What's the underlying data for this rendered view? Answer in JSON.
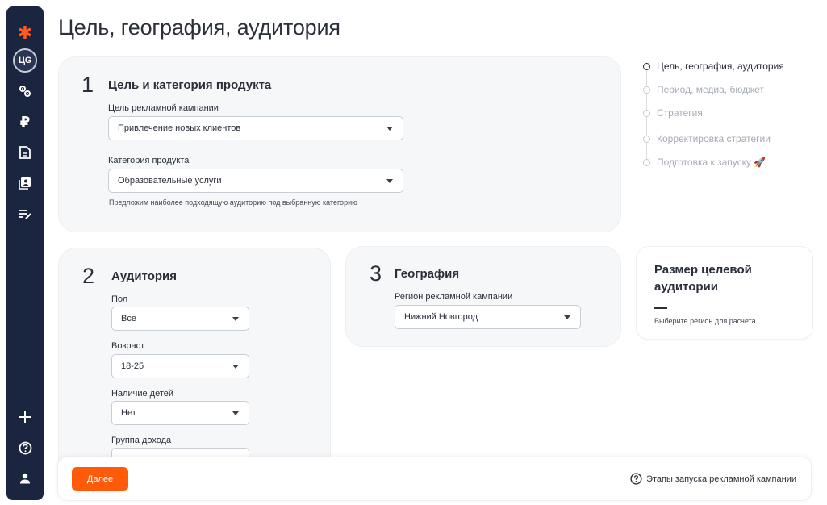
{
  "sidebar": {
    "logo_glyph": "✱",
    "avatar_initials": "ЦG",
    "ruble_glyph": "₽",
    "items": [
      {
        "icon": "gears-icon"
      },
      {
        "icon": "ruble-icon"
      },
      {
        "icon": "document-icon"
      },
      {
        "icon": "contacts-icon"
      },
      {
        "icon": "edit-list-icon"
      }
    ],
    "bottom": [
      {
        "icon": "plus-icon"
      },
      {
        "icon": "help-icon"
      },
      {
        "icon": "user-icon"
      }
    ]
  },
  "page": {
    "title": "Цель, география, аудитория"
  },
  "section_goal": {
    "number": "1",
    "title": "Цель и категория продукта",
    "goal_label": "Цель рекламной кампании",
    "goal_value": "Привлечение новых клиентов",
    "category_label": "Категория продукта",
    "category_value": "Образовательные услуги",
    "category_hint": "Предложим наиболее подходящую аудиторию под выбранную категорию"
  },
  "section_audience": {
    "number": "2",
    "title": "Аудитория",
    "gender_label": "Пол",
    "gender_value": "Все",
    "age_label": "Возраст",
    "age_value": "18-25",
    "children_label": "Наличие детей",
    "children_value": "Нет",
    "income_label": "Группа дохода"
  },
  "section_geo": {
    "number": "3",
    "title": "География",
    "region_label": "Регион рекламной кампании",
    "region_value": "Нижний Новгород"
  },
  "audience_size": {
    "title": "Размер целевой аудитории",
    "value": "—",
    "hint": "Выберите регион для расчета"
  },
  "stepper": {
    "steps": [
      {
        "label": "Цель, география, аудитория",
        "active": true
      },
      {
        "label": "Период, медиа, бюджет",
        "active": false
      },
      {
        "label": "Стратегия",
        "active": false
      },
      {
        "label": "Корректировка стратегии",
        "active": false
      },
      {
        "label": "Подготовка к запуску 🚀",
        "active": false
      }
    ]
  },
  "footer": {
    "next_label": "Далее",
    "help_label": "Этапы запуска рекламной кампании"
  },
  "colors": {
    "accent": "#ff5a0a",
    "sidebar_bg": "#1a2540",
    "card_bg": "#f6f7f9"
  }
}
